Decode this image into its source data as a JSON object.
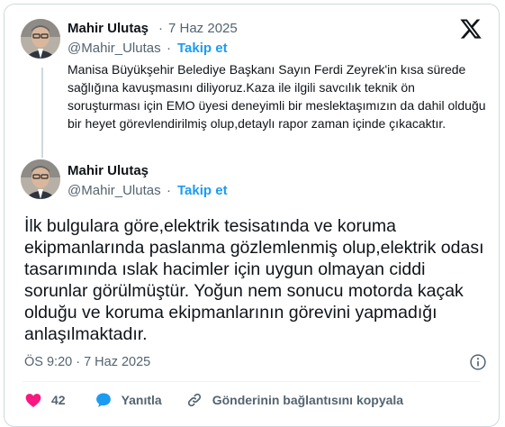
{
  "reply_tweet": {
    "author_name": "Mahir Ulutaş",
    "date": "7 Haz 2025",
    "handle": "@Mahir_Ulutas",
    "follow_label": "Takip et",
    "text": "Manisa Büyükşehir Belediye Başkanı Sayın Ferdi Zeyrek'in kısa sürede sağlığına kavuşmasını diliyoruz.Kaza ile ilgili savcılık teknik ön soruşturması için EMO üyesi deneyimli bir meslektaşımızın da dahil olduğu bir heyet görevlendirilmiş olup,detaylı rapor zaman içinde çıkacaktır."
  },
  "main_tweet": {
    "author_name": "Mahir Ulutaş",
    "handle": "@Mahir_Ulutas",
    "follow_label": "Takip et",
    "text": "İlk bulgulara göre,elektrik tesisatında ve koruma ekipmanlarında paslanma  gözlemlenmiş olup,elektrik odası tasarımında ıslak hacimler için uygun olmayan ciddi sorunlar görülmüştür. Yoğun nem sonucu motorda kaçak olduğu ve koruma ekipmanlarının görevini yapmadığı anlaşılmaktadır.",
    "timestamp": "ÖS 9:20 · 7 Haz 2025"
  },
  "actions": {
    "likes_count": "42",
    "reply_label": "Yanıtla",
    "copy_link_label": "Gönderinin bağlantısını kopyala"
  },
  "icons": {
    "logo": "x-logo-icon",
    "info": "info-icon",
    "like": "heart-icon",
    "reply": "reply-bubble-icon",
    "copy_link": "link-icon"
  },
  "colors": {
    "accent": "#1d9bf0",
    "like": "#f91880",
    "secondary_text": "#536471",
    "border": "#cfd9de"
  }
}
